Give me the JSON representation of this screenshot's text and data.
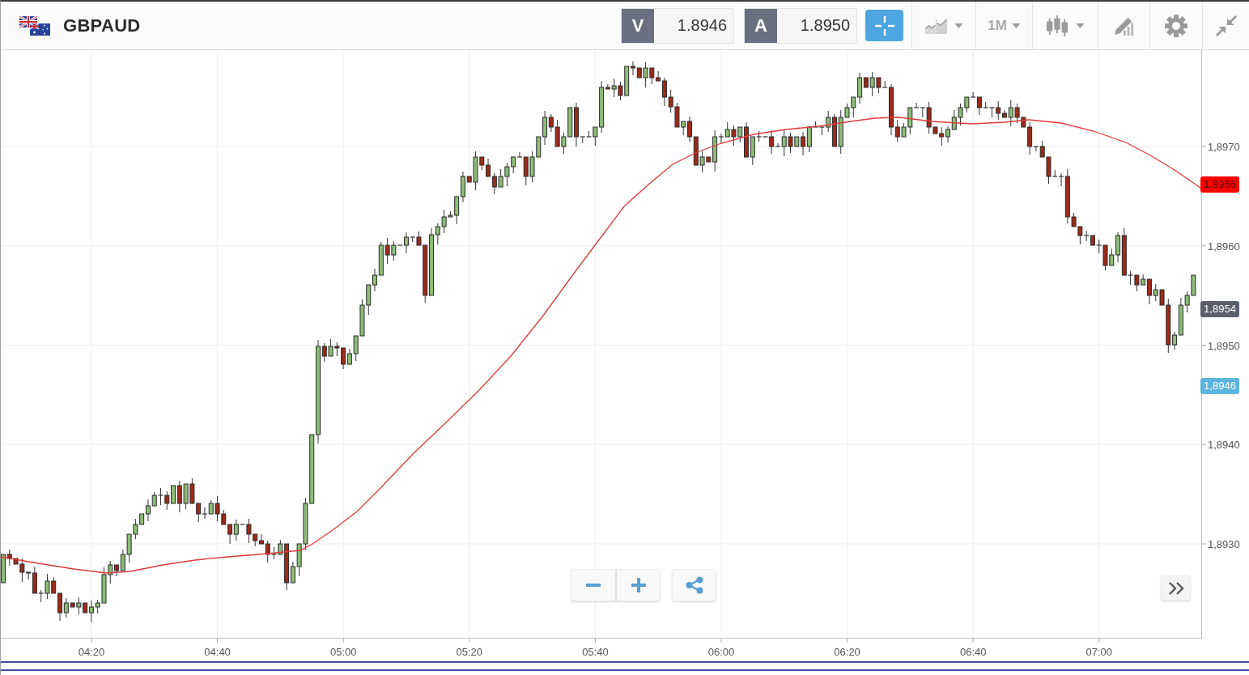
{
  "header": {
    "symbol": "GBPAUD",
    "quotes": [
      {
        "label": "V",
        "value": "1.8946"
      },
      {
        "label": "A",
        "value": "1.8950"
      }
    ]
  },
  "toolbar": [
    {
      "kind": "crosshair",
      "on": true,
      "dropdown": false
    },
    {
      "kind": "indicators",
      "on": false,
      "dropdown": true
    },
    {
      "kind": "timeframe",
      "label": "1M",
      "on": false,
      "dropdown": true
    },
    {
      "kind": "chart-type",
      "on": false,
      "dropdown": true
    },
    {
      "kind": "drawing",
      "on": false,
      "dropdown": false
    },
    {
      "kind": "settings",
      "on": false,
      "dropdown": false
    },
    {
      "kind": "collapse",
      "on": false,
      "dropdown": false
    }
  ],
  "price_axis": {
    "labels": [
      "1,8970",
      "1,8960",
      "1,8950",
      "1,8940",
      "1,8930"
    ],
    "badges": [
      {
        "kind": "indicator",
        "value": "1,8966",
        "color": "#ff0000"
      },
      {
        "kind": "last",
        "value": "1,8954",
        "color": "#5b5e6b"
      },
      {
        "kind": "bid",
        "value": "1,8946",
        "color": "#5ab4de"
      }
    ]
  },
  "time_axis": {
    "labels": [
      "04:20",
      "04:40",
      "05:00",
      "05:20",
      "05:40",
      "06:00",
      "06:20",
      "06:40",
      "07:00"
    ]
  },
  "chart_controls": [
    {
      "kind": "zoom-out"
    },
    {
      "kind": "zoom-in"
    },
    {
      "kind": "share"
    },
    {
      "kind": "scroll-to-end"
    }
  ]
}
